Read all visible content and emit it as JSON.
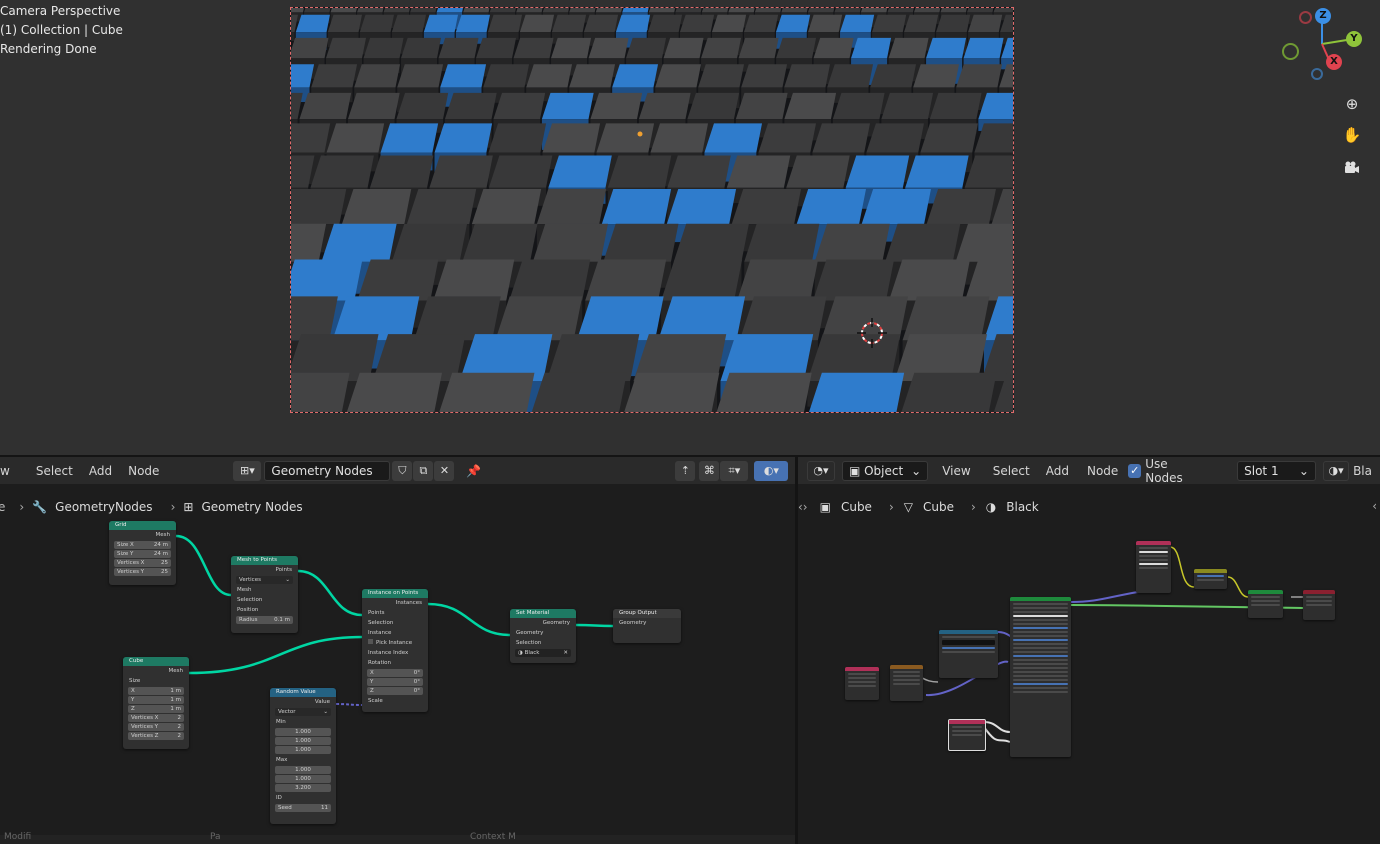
{
  "viewport": {
    "info_lines": [
      "Camera Perspective",
      "(1) Collection | Cube",
      "Rendering Done"
    ],
    "gizmo": {
      "z": "Z",
      "y": "Y",
      "x": "X"
    }
  },
  "geo_editor": {
    "menu": {
      "view": "w",
      "select": "Select",
      "add": "Add",
      "node": "Node"
    },
    "tree_name": "Geometry Nodes",
    "breadcrumb": {
      "modifier": "GeometryNodes",
      "tree": "Geometry Nodes"
    },
    "footer": {
      "a": "Modifi",
      "b": "Pa ",
      "c": "Context M"
    },
    "nodes": {
      "grid": {
        "title": "Grid",
        "out": "Mesh",
        "rows": [
          [
            "Size X",
            "24 m"
          ],
          [
            "Size Y",
            "24 m"
          ],
          [
            "Vertices X",
            "25"
          ],
          [
            "Vertices Y",
            "25"
          ]
        ]
      },
      "m2p": {
        "title": "Mesh to Points",
        "out": "Points",
        "mode": "Vertices",
        "inputs": [
          "Mesh",
          "Selection",
          "Position"
        ],
        "radius": [
          "Radius",
          "0.1 m"
        ]
      },
      "iop": {
        "title": "Instance on Points",
        "out": "Instances",
        "inputs": [
          "Points",
          "Selection",
          "Instance"
        ],
        "pick": "Pick Instance",
        "inputs2": [
          "Instance Index",
          "Rotation"
        ],
        "rot": [
          [
            "X",
            "0°"
          ],
          [
            "Y",
            "0°"
          ],
          [
            "Z",
            "0°"
          ]
        ],
        "scale": "Scale"
      },
      "setmat": {
        "title": "Set Material",
        "out": "Geometry",
        "inputs": [
          "Geometry",
          "Selection"
        ],
        "material": "Black"
      },
      "gout": {
        "title": "Group Output",
        "input": "Geometry"
      },
      "cube": {
        "title": "Cube",
        "out": "Mesh",
        "size": "Size",
        "rows": [
          [
            "X",
            "1 m"
          ],
          [
            "Y",
            "1 m"
          ],
          [
            "Z",
            "1 m"
          ],
          [
            "Vertices X",
            "2"
          ],
          [
            "Vertices Y",
            "2"
          ],
          [
            "Vertices Z",
            "2"
          ]
        ]
      },
      "rand": {
        "title": "Random Value",
        "out": "Value",
        "type": "Vector",
        "min": "Min",
        "min_vals": [
          "1.000",
          "1.000",
          "1.000"
        ],
        "max": "Max",
        "max_vals": [
          "1.000",
          "1.000",
          "3.200"
        ],
        "id": "ID",
        "seed": [
          "Seed",
          "11"
        ]
      }
    }
  },
  "shader_editor": {
    "object_mode": "Object",
    "menu": {
      "view": "View",
      "select": "Select",
      "add": "Add",
      "node": "Node"
    },
    "use_nodes": "Use Nodes",
    "slot": "Slot 1",
    "material_short": "Bla",
    "breadcrumb": {
      "object": "Cube",
      "mesh": "Cube",
      "material": "Black"
    }
  },
  "colors": {
    "geometry_header": "#1e7a63",
    "input_header": "#1e7a63",
    "converter_header": "#246283",
    "link_geometry": "#00d6a3",
    "link_float": "#a1a1a1",
    "link_vector": "#6363c7",
    "cube_blue": "#2f7ccc"
  },
  "icons": [
    "editor-type-icon",
    "modifier-wrench-icon",
    "node-tree-icon",
    "shield-icon",
    "copy-icon",
    "close-icon",
    "pin-icon",
    "parent-icon",
    "snap-icon",
    "overlay-icon",
    "shading-icon",
    "zoom-icon",
    "hand-icon",
    "camera-icon",
    "object-mode-icon",
    "material-icon"
  ]
}
